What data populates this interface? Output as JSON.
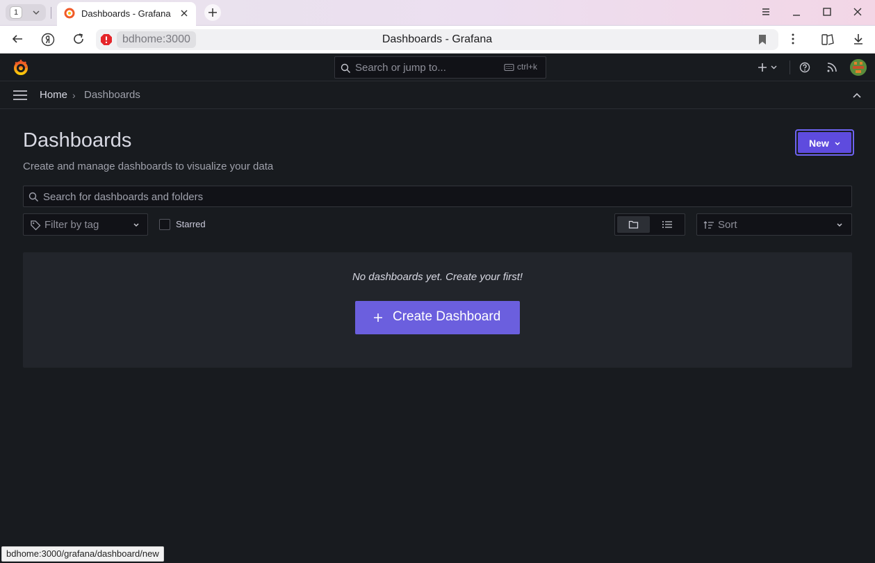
{
  "browser": {
    "tab_count": "1",
    "tab_title": "Dashboards - Grafana",
    "url_host": "bdhome:3000",
    "page_title": "Dashboards - Grafana",
    "status_url": "bdhome:3000/grafana/dashboard/new"
  },
  "topbar": {
    "search_placeholder": "Search or jump to...",
    "search_shortcut": "ctrl+k"
  },
  "breadcrumb": {
    "home": "Home",
    "separator": "›",
    "current": "Dashboards"
  },
  "main": {
    "title": "Dashboards",
    "subtitle": "Create and manage dashboards to visualize your data",
    "new_button": "New",
    "search_placeholder": "Search for dashboards and folders",
    "tag_filter_placeholder": "Filter by tag",
    "starred_label": "Starred",
    "sort_placeholder": "Sort",
    "empty_message": "No dashboards yet. Create your first!",
    "create_button": "Create Dashboard"
  },
  "colors": {
    "background": "#181b1f",
    "primary": "#6b5fde",
    "panel": "#22252b",
    "accent_logo": "#f05a28"
  }
}
